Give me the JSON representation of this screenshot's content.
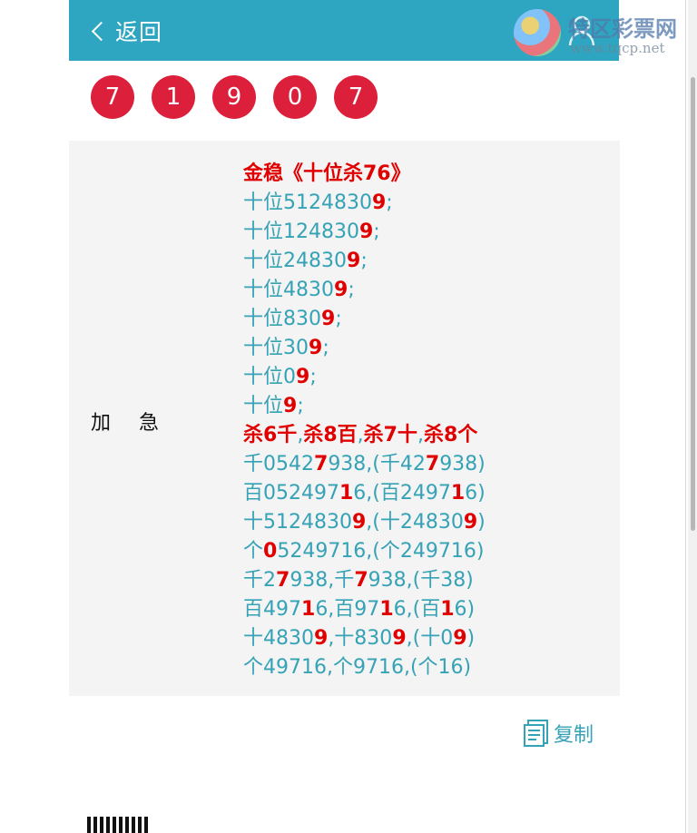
{
  "header": {
    "back_label": "返回",
    "logo_text": "特区彩票网",
    "logo_url": "www.tqcp.net"
  },
  "numbers": [
    "7",
    "1",
    "9",
    "0",
    "7"
  ],
  "section_label": "加 急",
  "lines": [
    [
      {
        "t": "金稳《十位杀76》",
        "b": true
      }
    ],
    [
      {
        "t": "十位5124830"
      },
      {
        "t": "9",
        "b": true
      },
      {
        "t": ";"
      }
    ],
    [
      {
        "t": "十位124830"
      },
      {
        "t": "9",
        "b": true
      },
      {
        "t": ";"
      }
    ],
    [
      {
        "t": "十位24830"
      },
      {
        "t": "9",
        "b": true
      },
      {
        "t": ";"
      }
    ],
    [
      {
        "t": "十位4830"
      },
      {
        "t": "9",
        "b": true
      },
      {
        "t": ";"
      }
    ],
    [
      {
        "t": "十位830"
      },
      {
        "t": "9",
        "b": true
      },
      {
        "t": ";"
      }
    ],
    [
      {
        "t": "十位30"
      },
      {
        "t": "9",
        "b": true
      },
      {
        "t": ";"
      }
    ],
    [
      {
        "t": "十位0"
      },
      {
        "t": "9",
        "b": true
      },
      {
        "t": ";"
      }
    ],
    [
      {
        "t": "十位"
      },
      {
        "t": "9",
        "b": true
      },
      {
        "t": ";"
      }
    ],
    [
      {
        "t": "杀6千",
        "b": true
      },
      {
        "t": ","
      },
      {
        "t": "杀8百",
        "b": true
      },
      {
        "t": ","
      },
      {
        "t": "杀7十",
        "b": true
      },
      {
        "t": ","
      },
      {
        "t": "杀8个",
        "b": true
      }
    ],
    [
      {
        "t": "千0542"
      },
      {
        "t": "7",
        "b": true
      },
      {
        "t": "938,(千42"
      },
      {
        "t": "7",
        "b": true
      },
      {
        "t": "938)"
      }
    ],
    [
      {
        "t": "百052497"
      },
      {
        "t": "1",
        "b": true
      },
      {
        "t": "6,(百2497"
      },
      {
        "t": "1",
        "b": true
      },
      {
        "t": "6)"
      }
    ],
    [
      {
        "t": "十5124830"
      },
      {
        "t": "9",
        "b": true
      },
      {
        "t": ",(十24830"
      },
      {
        "t": "9",
        "b": true
      },
      {
        "t": ")"
      }
    ],
    [
      {
        "t": "个"
      },
      {
        "t": "0",
        "b": true
      },
      {
        "t": "5249716,(个249716)"
      }
    ],
    [
      {
        "t": "千2"
      },
      {
        "t": "7",
        "b": true
      },
      {
        "t": "938,千"
      },
      {
        "t": "7",
        "b": true
      },
      {
        "t": "938,(千38)"
      }
    ],
    [
      {
        "t": "百497"
      },
      {
        "t": "1",
        "b": true
      },
      {
        "t": "6,百97"
      },
      {
        "t": "1",
        "b": true
      },
      {
        "t": "6,(百"
      },
      {
        "t": "1",
        "b": true
      },
      {
        "t": "6)"
      }
    ],
    [
      {
        "t": "十4830"
      },
      {
        "t": "9",
        "b": true
      },
      {
        "t": ",十830"
      },
      {
        "t": "9",
        "b": true
      },
      {
        "t": ",(十0"
      },
      {
        "t": "9",
        "b": true
      },
      {
        "t": ")"
      }
    ],
    [
      {
        "t": "个49716,个9716,(个16)"
      }
    ]
  ],
  "copy_label": "复制",
  "colors": {
    "header_bg": "#2fa6c1",
    "ball_bg": "#dc1f3a",
    "text_teal": "#35a2b6",
    "highlight_red": "#e00000"
  },
  "icons": [
    "chevron-left-icon",
    "user-icon",
    "copy-icon",
    "qr-code-icon"
  ]
}
